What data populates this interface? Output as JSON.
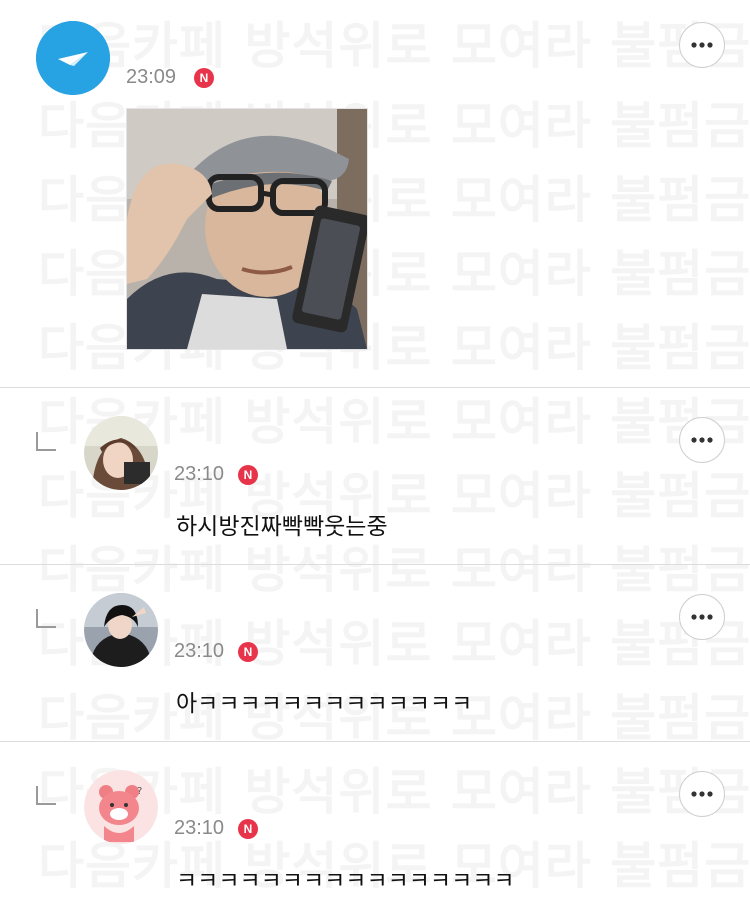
{
  "watermark_text": "다음카페 방석위로 모여라 불펌금지",
  "accent_color": "#e8344a",
  "icons": {
    "more": "more-horizontal-icon",
    "reply": "reply-arrow-icon",
    "new": "new-badge"
  },
  "comments": [
    {
      "time": "23:09",
      "badge": "N",
      "text": "",
      "has_photo": true,
      "is_reply": false,
      "avatar": "paper-plane-avatar"
    },
    {
      "time": "23:10",
      "badge": "N",
      "text": "하시방진짜빡빡웃는중",
      "has_photo": false,
      "is_reply": true,
      "avatar": "profile-photo-woman"
    },
    {
      "time": "23:10",
      "badge": "N",
      "text": "아ㅋㅋㅋㅋㅋㅋㅋㅋㅋㅋㅋㅋㅋ",
      "has_photo": false,
      "is_reply": true,
      "avatar": "profile-photo-woman-2"
    },
    {
      "time": "23:10",
      "badge": "N",
      "text": "ㅋㅋㅋㅋㅋㅋㅋㅋㅋㅋㅋㅋㅋㅋㅋㅋ",
      "has_photo": false,
      "is_reply": true,
      "avatar": "profile-cartoon-bear"
    }
  ]
}
